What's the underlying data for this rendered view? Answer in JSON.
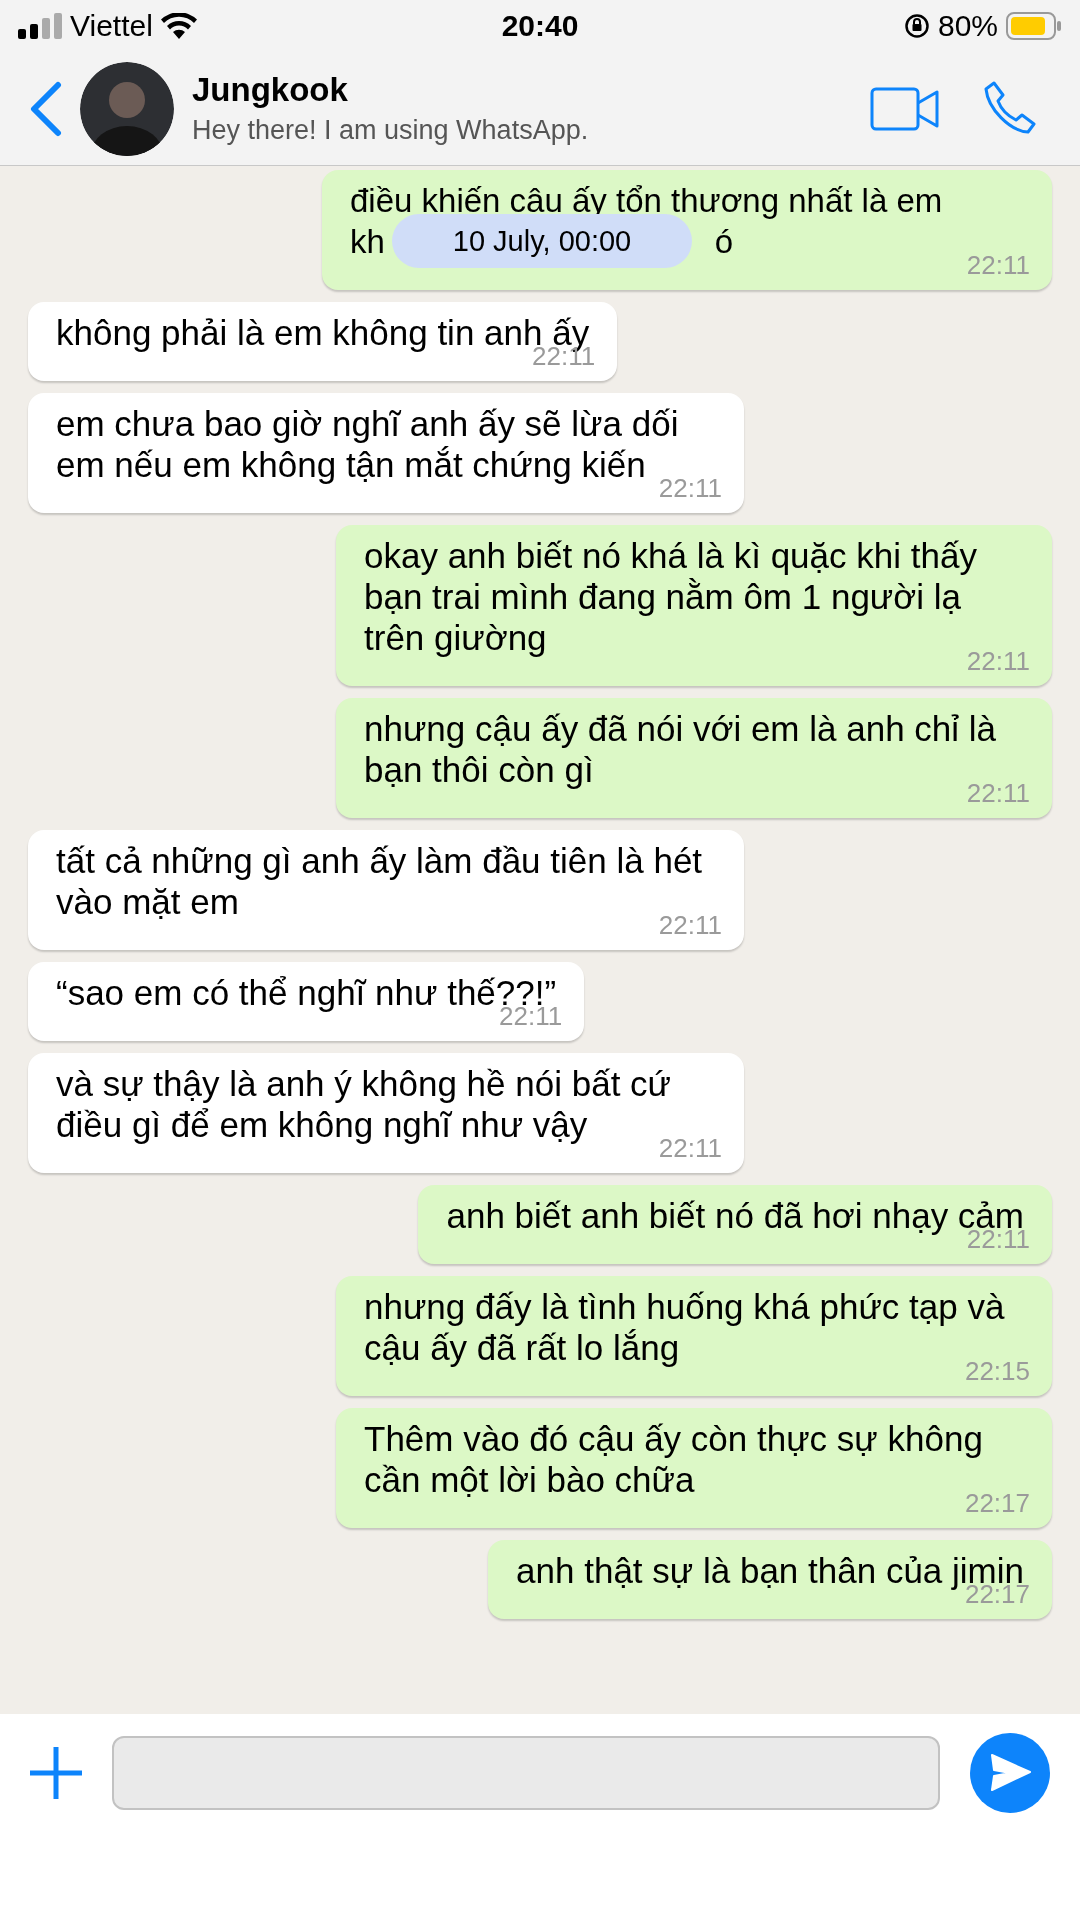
{
  "status_bar": {
    "carrier": "Viettel",
    "time": "20:40",
    "battery": "80%"
  },
  "header": {
    "name": "Jungkook",
    "status": "Hey there! I am using WhatsApp."
  },
  "partial_message": {
    "kind": "out",
    "lines": [
      "điều khiến cậu ấy tổn thương nhất là em"
    ],
    "start": "kh",
    "end": "ó",
    "time": "22:11"
  },
  "date_chip": "10 July, 00:00",
  "messages": [
    {
      "kind": "in",
      "text": "không phải là em không tin anh ấy",
      "time": "22:11"
    },
    {
      "kind": "in",
      "text": "em chưa bao giờ nghĩ anh ấy sẽ lừa dối em nếu em không tận mắt chứng kiến",
      "time": "22:11"
    },
    {
      "kind": "out",
      "text": "okay anh biết nó khá là kì quặc khi thấy bạn trai mình đang nằm ôm 1 người lạ trên giường",
      "time": "22:11"
    },
    {
      "kind": "out",
      "text": "nhưng cậu ấy đã nói với em là anh chỉ là bạn thôi còn gì",
      "time": "22:11"
    },
    {
      "kind": "in",
      "text": "tất cả những gì anh ấy làm đầu tiên là hét vào mặt em",
      "time": "22:11"
    },
    {
      "kind": "in",
      "text": "“sao em có thể nghĩ như thế??!”",
      "time": "22:11"
    },
    {
      "kind": "in",
      "text": "và sự thậy là anh ý không hề nói bất cứ điều gì để em không nghĩ như vậy",
      "time": "22:11"
    },
    {
      "kind": "out",
      "text": "anh biết anh biết nó đã hơi nhạy cảm",
      "time": "22:11"
    },
    {
      "kind": "out",
      "text": "nhưng đấy là tình huống khá phức tạp và cậu ấy đã rất lo lắng",
      "time": "22:15"
    },
    {
      "kind": "out",
      "text": "Thêm vào đó cậu ấy còn thực sự không cần một lời bào chữa",
      "time": "22:17"
    },
    {
      "kind": "out",
      "text": "anh thật sự là bạn thân của jimin",
      "time": "22:17"
    }
  ]
}
